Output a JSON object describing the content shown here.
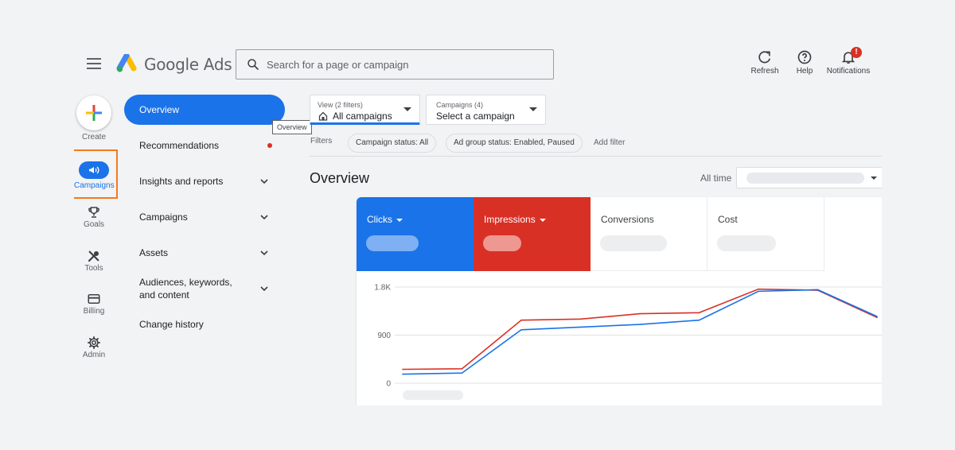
{
  "header": {
    "brand": "Google Ads",
    "search_placeholder": "Search for a page or campaign",
    "actions": [
      {
        "label": "Refresh",
        "icon": "refresh-icon"
      },
      {
        "label": "Help",
        "icon": "help-icon"
      },
      {
        "label": "Notifications",
        "icon": "bell-icon",
        "badge": "!"
      }
    ]
  },
  "rail": {
    "create_label": "Create",
    "items": [
      {
        "label": "Campaigns",
        "icon": "megaphone-icon",
        "active": true
      },
      {
        "label": "Goals",
        "icon": "trophy-icon"
      },
      {
        "label": "Tools",
        "icon": "tools-icon"
      },
      {
        "label": "Billing",
        "icon": "credit-card-icon"
      },
      {
        "label": "Admin",
        "icon": "gear-icon"
      }
    ]
  },
  "nav": {
    "items": [
      {
        "label": "Overview",
        "active": true
      },
      {
        "label": "Recommendations",
        "dot": true
      },
      {
        "label": "Insights and reports",
        "expandable": true
      },
      {
        "label": "Campaigns",
        "expandable": true
      },
      {
        "label": "Assets",
        "expandable": true
      },
      {
        "label": "Audiences, keywords, and content",
        "expandable": true
      },
      {
        "label": "Change history"
      }
    ],
    "tooltip": "Overview"
  },
  "filters": {
    "view_small": "View (2 filters)",
    "view_value": "All campaigns",
    "campaigns_small": "Campaigns (4)",
    "campaigns_value": "Select a campaign",
    "label": "Filters",
    "chips": [
      "Campaign status: All",
      "Ad group status: Enabled, Paused"
    ],
    "add_filter": "Add filter"
  },
  "main": {
    "title": "Overview",
    "date_range_label": "All time"
  },
  "metrics": [
    {
      "name": "Clicks",
      "selected": true,
      "color": "#1a73e8"
    },
    {
      "name": "Impressions",
      "selected": true,
      "color": "#d93025"
    },
    {
      "name": "Conversions",
      "selected": false
    },
    {
      "name": "Cost",
      "selected": false
    }
  ],
  "colors": {
    "accent": "#1a73e8",
    "clicks": "#1a73e8",
    "impressions": "#d93025",
    "highlight": "#f47920"
  },
  "chart_data": {
    "type": "line",
    "y_ticks": [
      "1.8K",
      "900",
      "0"
    ],
    "ylim": [
      0,
      1800
    ],
    "grid": true,
    "x": [
      0,
      1,
      2,
      3,
      4,
      5,
      6,
      7,
      8
    ],
    "series": [
      {
        "name": "Clicks",
        "color": "#1a73e8",
        "values": [
          170,
          190,
          1000,
          1050,
          1100,
          1180,
          1720,
          1750,
          1250
        ]
      },
      {
        "name": "Impressions",
        "color": "#d93025",
        "values": [
          260,
          270,
          1180,
          1200,
          1300,
          1320,
          1760,
          1740,
          1230
        ]
      }
    ]
  }
}
